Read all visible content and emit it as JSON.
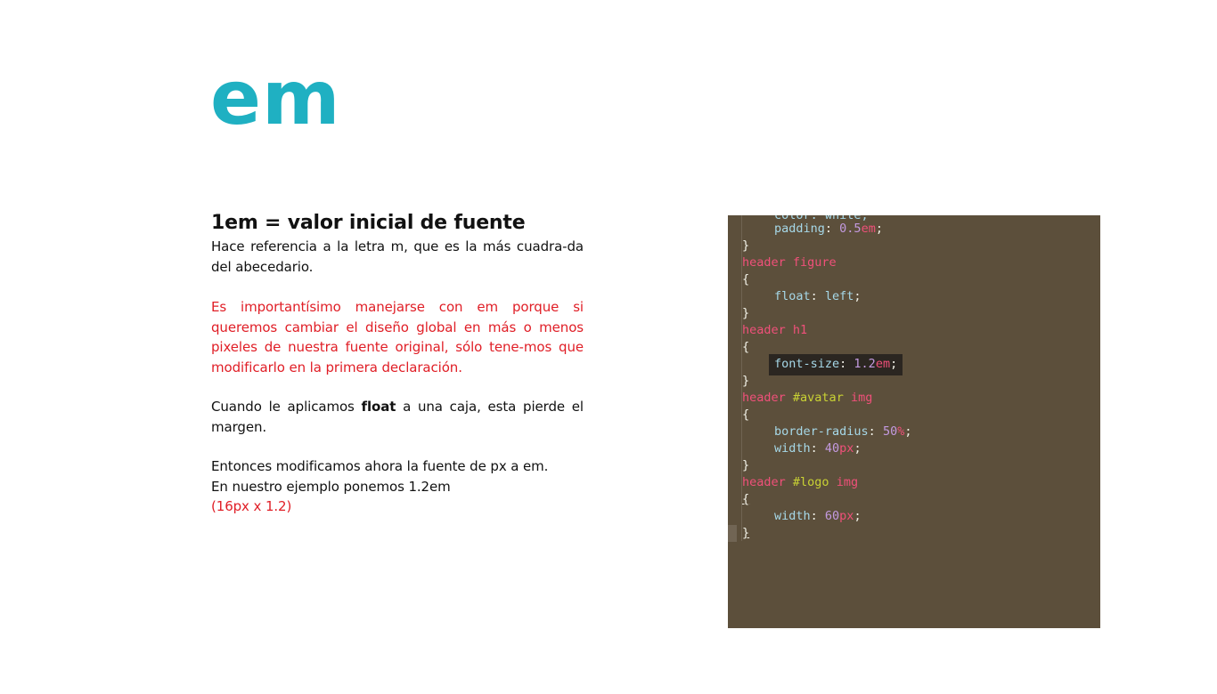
{
  "title": "em",
  "heading": "1em = valor inicial de fuente",
  "paragraphs": {
    "p1": "Hace referencia a la letra m, que es la más cuadra-da del abecedario.",
    "p2": "Es importantísimo manejarse con em porque si queremos cambiar el diseño global en más o menos pixeles de nuestra fuente original, sólo tene-mos que modificarlo en la primera declaración.",
    "p3_before": "Cuando le aplicamos ",
    "p3_bold": "float",
    "p3_after": " a una caja, esta pierde el margen.",
    "p4_line1": "Entonces modificamos ahora la fuente de px a em.",
    "p4_line2": "En nuestro ejemplo ponemos 1.2em",
    "p4_line3": "(16px x 1.2)"
  },
  "code": {
    "partial_top": "color: white;",
    "padding_prop": "padding",
    "padding_num": "0.5",
    "padding_unit": "em",
    "sel_figure": "header figure",
    "float_prop": "float",
    "float_val": "left",
    "sel_h1": "header h1",
    "fontsize_prop": "font-size",
    "fontsize_num": "1.2",
    "fontsize_unit": "em",
    "sel_avatar_tag": "header",
    "sel_avatar_id": "#avatar",
    "sel_avatar_el": "img",
    "radius_prop": "border-radius",
    "radius_num": "50",
    "radius_unit": "%",
    "width1_prop": "width",
    "width1_num": "40",
    "width1_unit": "px",
    "sel_logo_tag": "header",
    "sel_logo_id": "#logo",
    "sel_logo_el": "img",
    "width2_prop": "width",
    "width2_num": "60",
    "width2_unit": "px",
    "open_brace": "{",
    "close_brace": "}"
  },
  "colors": {
    "title": "#1fb0c2",
    "accent_red": "#e01e26",
    "code_background": "#5c4f3b"
  }
}
